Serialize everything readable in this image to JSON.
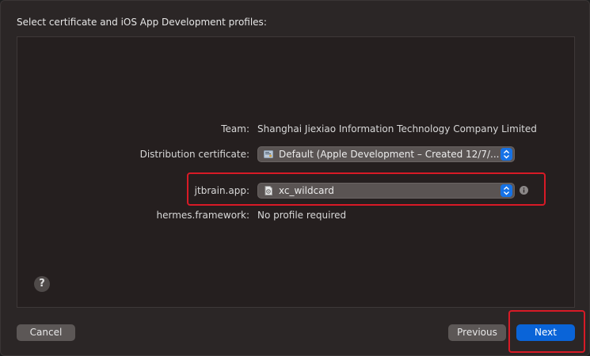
{
  "heading": "Select certificate and iOS App Development profiles:",
  "rows": {
    "team": {
      "label": "Team:",
      "value": "Shanghai Jiexiao Information Technology Company Limited"
    },
    "distribution_certificate": {
      "label": "Distribution certificate:",
      "value": "Default (Apple Development – Created 12/7/..."
    },
    "jtbrain_app": {
      "label": "jtbrain.app:",
      "value": "xc_wildcard"
    },
    "hermes_framework": {
      "label": "hermes.framework:",
      "value": "No profile required"
    }
  },
  "help": {
    "glyph": "?"
  },
  "buttons": {
    "cancel": "Cancel",
    "previous": "Previous",
    "next": "Next"
  },
  "colors": {
    "accent": "#0a64d8",
    "highlight": "#d81a26",
    "sheet_background": "#2b2626"
  },
  "icons": {
    "certificate": "certificate-icon",
    "profile": "provisioning-profile-icon",
    "stepper": "popup-stepper-icon",
    "info": "info-icon",
    "help": "help-icon"
  }
}
